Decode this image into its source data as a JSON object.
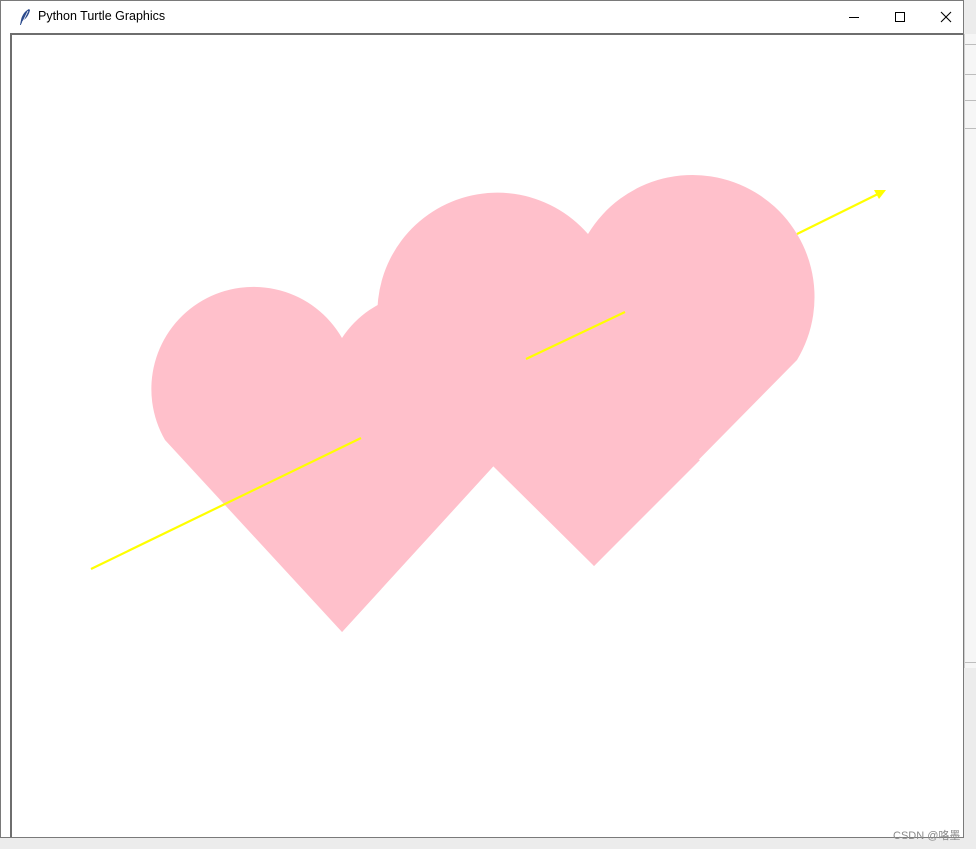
{
  "window": {
    "title": "Python Turtle Graphics",
    "icon": "feather-icon",
    "controls": {
      "minimize": "minimize-icon",
      "maximize": "maximize-icon",
      "close": "close-icon"
    }
  },
  "canvas": {
    "background": "#ffffff",
    "heart_color": "#ffc0cb",
    "arrow_color": "#ffff00",
    "shapes": [
      "heart-left",
      "heart-right",
      "arrow-line"
    ]
  },
  "watermark": {
    "text": "CSDN @咯墨"
  }
}
